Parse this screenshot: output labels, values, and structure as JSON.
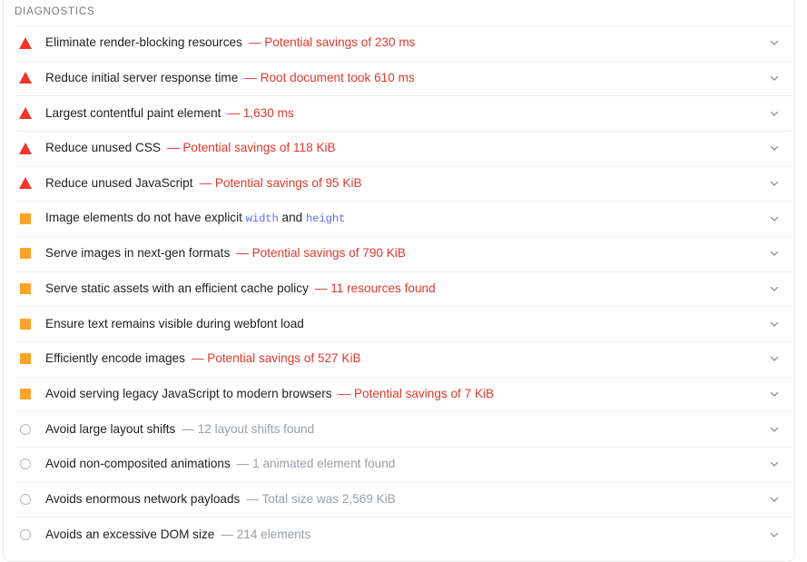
{
  "panel": {
    "header": "DIAGNOSTICS",
    "expand_icon": "chevron-down-icon"
  },
  "colors": {
    "fail": "#f4352a",
    "average": "#fca429",
    "pass": "#b9b9b9",
    "sub_red": "#e1392c",
    "sub_gray": "#9aa0a6",
    "code_blue": "#5f6df0",
    "border": "#ebebeb",
    "separator": "#eeeeee",
    "title_text": "#202124",
    "header_text": "#78797c"
  },
  "audits": [
    {
      "icon": "fail-triangle-icon",
      "severity": "fail",
      "title": "Eliminate render-blocking resources",
      "sub": "— Potential savings of 230 ms",
      "sub_tone": "red"
    },
    {
      "icon": "fail-triangle-icon",
      "severity": "fail",
      "title": "Reduce initial server response time",
      "sub": "— Root document took 610 ms",
      "sub_tone": "red"
    },
    {
      "icon": "fail-triangle-icon",
      "severity": "fail",
      "title": "Largest contentful paint element",
      "sub": "— 1,630 ms",
      "sub_tone": "red"
    },
    {
      "icon": "fail-triangle-icon",
      "severity": "fail",
      "title": "Reduce unused CSS",
      "sub": "— Potential savings of 118 KiB",
      "sub_tone": "red"
    },
    {
      "icon": "fail-triangle-icon",
      "severity": "fail",
      "title": "Reduce unused JavaScript",
      "sub": "— Potential savings of 95 KiB",
      "sub_tone": "red"
    },
    {
      "icon": "average-square-icon",
      "severity": "average",
      "title_html": "Image elements do not have explicit <span class=\"code\">width</span> and <span class=\"code\">height</span>",
      "title": "Image elements do not have explicit width and height",
      "sub": "",
      "sub_tone": "red"
    },
    {
      "icon": "average-square-icon",
      "severity": "average",
      "title": "Serve images in next-gen formats",
      "sub": "— Potential savings of 790 KiB",
      "sub_tone": "red"
    },
    {
      "icon": "average-square-icon",
      "severity": "average",
      "title": "Serve static assets with an efficient cache policy",
      "sub": "— 11 resources found",
      "sub_tone": "red"
    },
    {
      "icon": "average-square-icon",
      "severity": "average",
      "title": "Ensure text remains visible during webfont load",
      "sub": "",
      "sub_tone": "red"
    },
    {
      "icon": "average-square-icon",
      "severity": "average",
      "title": "Efficiently encode images",
      "sub": "— Potential savings of 527 KiB",
      "sub_tone": "red"
    },
    {
      "icon": "average-square-icon",
      "severity": "average",
      "title": "Avoid serving legacy JavaScript to modern browsers",
      "sub": "— Potential savings of 7 KiB",
      "sub_tone": "red"
    },
    {
      "icon": "pass-circle-icon",
      "severity": "pass",
      "title": "Avoid large layout shifts",
      "sub": "— 12 layout shifts found",
      "sub_tone": "gray"
    },
    {
      "icon": "pass-circle-icon",
      "severity": "pass",
      "title": "Avoid non-composited animations",
      "sub": "— 1 animated element found",
      "sub_tone": "gray"
    },
    {
      "icon": "pass-circle-icon",
      "severity": "pass",
      "title": "Avoids enormous network payloads",
      "sub": "— Total size was 2,569 KiB",
      "sub_tone": "gray"
    },
    {
      "icon": "pass-circle-icon",
      "severity": "pass",
      "title": "Avoids an excessive DOM size",
      "sub": "— 214 elements",
      "sub_tone": "gray"
    }
  ]
}
